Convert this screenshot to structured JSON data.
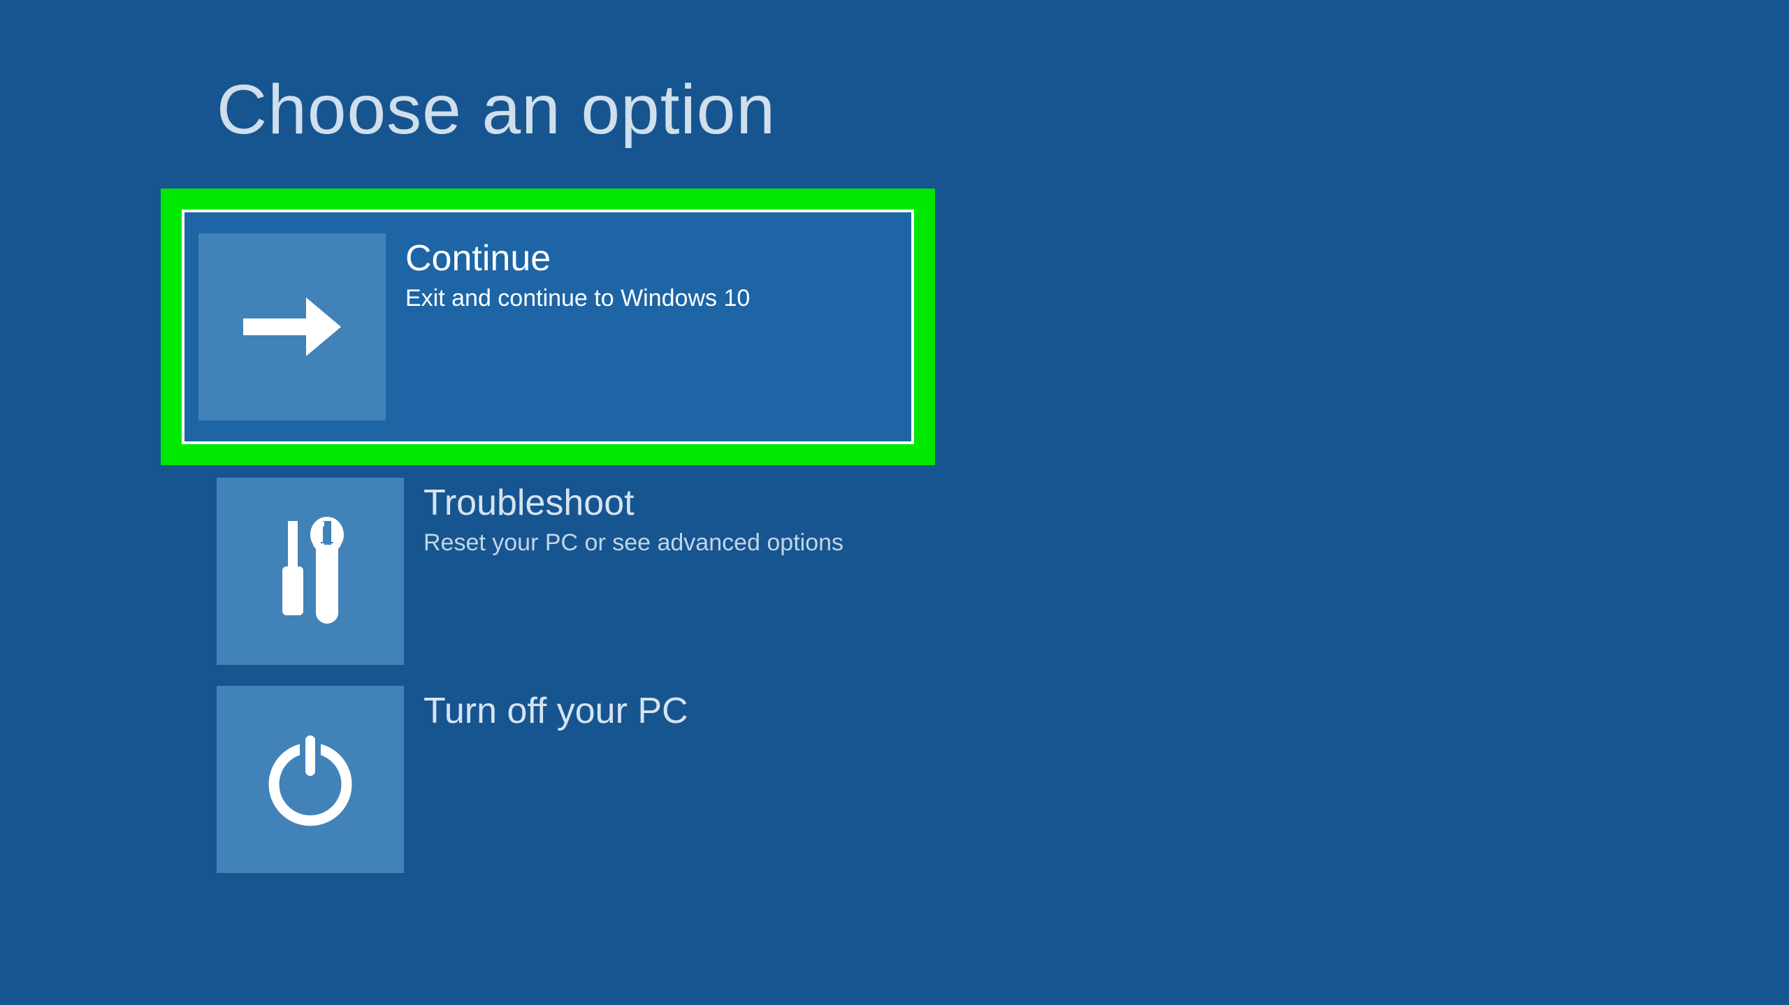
{
  "page": {
    "title": "Choose an option"
  },
  "options": {
    "continue": {
      "title": "Continue",
      "desc": "Exit and continue to Windows 10"
    },
    "troubleshoot": {
      "title": "Troubleshoot",
      "desc": "Reset your PC or see advanced options"
    },
    "turnoff": {
      "title": "Turn off your PC",
      "desc": ""
    }
  },
  "colors": {
    "background": "#175591",
    "tile": "#4182b9",
    "highlight": "#00e800",
    "selectedBg": "#1d65a5"
  }
}
